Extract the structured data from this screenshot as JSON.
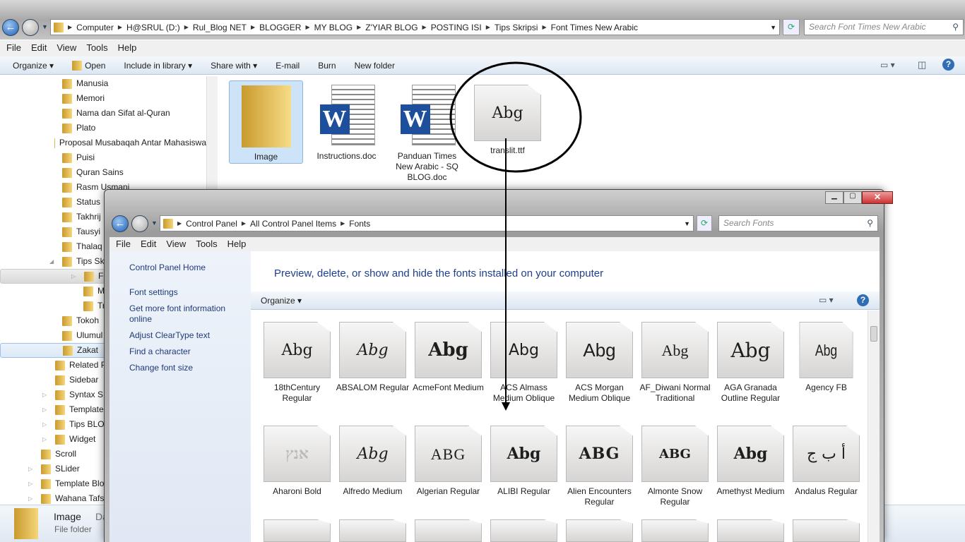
{
  "back": {
    "breadcrumb": [
      "Computer",
      "H@SRUL (D:)",
      "Rul_Blog NET",
      "BLOGGER",
      "MY BLOG",
      "Z'YIAR BLOG",
      "POSTING ISI",
      "Tips Skripsi",
      "Font Times New Arabic"
    ],
    "search_placeholder": "Search Font Times New Arabic",
    "menu": [
      "File",
      "Edit",
      "View",
      "Tools",
      "Help"
    ],
    "toolbar": [
      "Organize ▾",
      "Open",
      "Include in library ▾",
      "Share with ▾",
      "E-mail",
      "Burn",
      "New folder"
    ],
    "tree": [
      "Manusia",
      "Memori",
      "Nama dan Sifat al-Quran",
      "Plato",
      "Proposal Musabaqah Antar Mahasiswa",
      "Puisi",
      "Quran Sains",
      "Rasm Usmani",
      "Status",
      "Takhrij",
      "Tausyi",
      "Thalaq",
      "Tips Skripsi",
      "Font",
      "Memori",
      "Transliterasi",
      "Tokoh",
      "Ulumul",
      "Zakat",
      "Related Post",
      "Sidebar",
      "Syntax SH",
      "Template",
      "Tips BLOG",
      "Widget",
      "Scroll",
      "SLider",
      "Template Blog",
      "Wahana Tafsir"
    ],
    "files": [
      {
        "name": "Image",
        "type": "folder"
      },
      {
        "name": "Instructions.doc",
        "type": "word"
      },
      {
        "name": "Panduan Times New Arabic - SQ BLOG.doc",
        "type": "word"
      },
      {
        "name": "translit.ttf",
        "type": "font",
        "preview": "Abg"
      }
    ],
    "details": {
      "name": "Image",
      "type": "File folder",
      "extra": "Da"
    }
  },
  "front": {
    "title": "Fonts",
    "breadcrumb": [
      "Control Panel",
      "All Control Panel Items",
      "Fonts"
    ],
    "search_placeholder": "Search Fonts",
    "menu": [
      "File",
      "Edit",
      "View",
      "Tools",
      "Help"
    ],
    "side_links": [
      "Control Panel Home",
      "Font settings",
      "Get more font information online",
      "Adjust ClearType text",
      "Find a character",
      "Change font size"
    ],
    "heading": "Preview, delete, or show and hide the fonts installed on your computer",
    "organize": "Organize ▾",
    "fonts": [
      {
        "name": "18thCentury Regular",
        "preview": "Abg"
      },
      {
        "name": "ABSALOM Regular",
        "preview": "Abg"
      },
      {
        "name": "AcmeFont Medium",
        "preview": "Abg"
      },
      {
        "name": "ACS Almass Medium Oblique",
        "preview": "Abg"
      },
      {
        "name": "ACS Morgan Medium Oblique",
        "preview": "Abg"
      },
      {
        "name": "AF_Diwani Normal Traditional",
        "preview": "Abg"
      },
      {
        "name": "AGA Granada Outline Regular",
        "preview": "Abg"
      },
      {
        "name": "Agency FB",
        "preview": "Abg"
      },
      {
        "name": "Aharoni Bold",
        "preview": "אנץ"
      },
      {
        "name": "Alfredo Medium",
        "preview": "Abg"
      },
      {
        "name": "Algerian Regular",
        "preview": "ABG"
      },
      {
        "name": "ALIBI Regular",
        "preview": "Abg"
      },
      {
        "name": "Alien Encounters Regular",
        "preview": "ABG"
      },
      {
        "name": "Almonte Snow Regular",
        "preview": "ABG"
      },
      {
        "name": "Amethyst Medium",
        "preview": "Abg"
      },
      {
        "name": "Andalus Regular",
        "preview": "أ ب ج"
      }
    ]
  }
}
